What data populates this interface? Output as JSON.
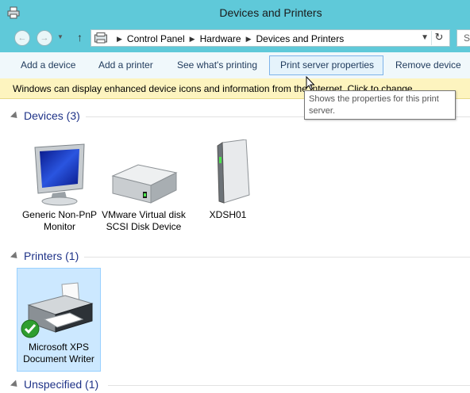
{
  "window": {
    "title": "Devices and Printers"
  },
  "address": {
    "breadcrumbs": [
      "Control Panel",
      "Hardware",
      "Devices and Printers"
    ],
    "search_placeholder": "S"
  },
  "commands": [
    "Add a device",
    "Add a printer",
    "See what's printing",
    "Print server properties",
    "Remove device"
  ],
  "infobar": {
    "text": "Windows can display enhanced device icons and information from the Internet. Click to change..."
  },
  "tooltip": {
    "text": "Shows the properties for this print server."
  },
  "groups": {
    "devices": {
      "label": "Devices (3)",
      "items": [
        "Generic Non-PnP Monitor",
        "VMware Virtual disk SCSI Disk Device",
        "XDSH01"
      ]
    },
    "printers": {
      "label": "Printers (1)",
      "items": [
        "Microsoft XPS Document Writer"
      ]
    },
    "unspecified": {
      "label": "Unspecified (1)"
    }
  },
  "colors": {
    "titlebar": "#5fc9d9",
    "group_label": "#1e3287",
    "selection": "#cce8ff",
    "infobar": "#fdf4bf"
  }
}
